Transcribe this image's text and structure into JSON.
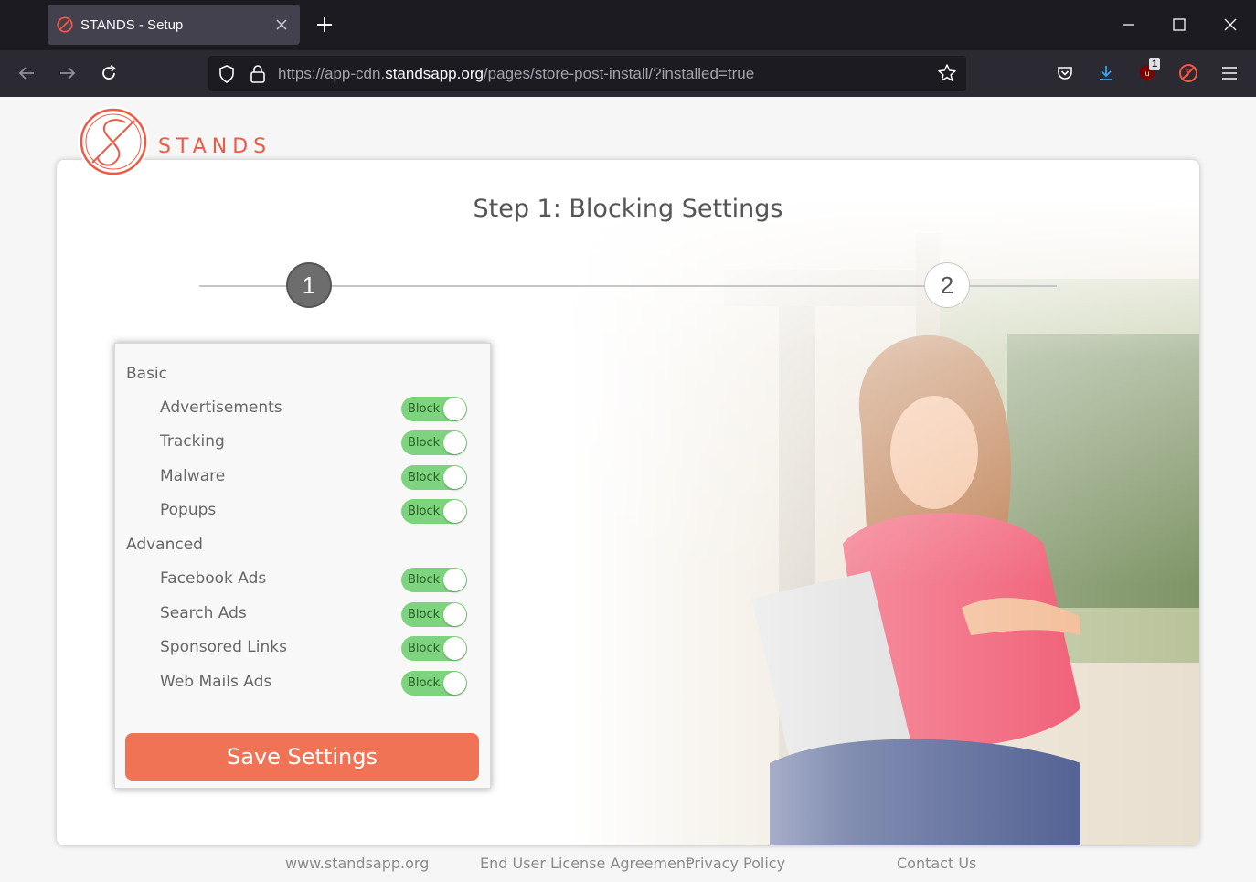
{
  "browser": {
    "tab_title": "STANDS - Setup",
    "url_prefix": "https://app-cdn.",
    "url_host": "standsapp.org",
    "url_path": "/pages/store-post-install/?installed=true",
    "extension_badge": "1",
    "icons": {
      "back": "arrow-left-icon",
      "forward": "arrow-right-icon",
      "reload": "reload-icon",
      "shield": "shield-icon",
      "lock": "lock-icon",
      "bookmark": "star-icon",
      "pocket": "pocket-icon",
      "downloads": "download-icon",
      "ublock": "ublock-icon",
      "stands": "stands-extension-icon",
      "menu": "hamburger-menu-icon"
    }
  },
  "page": {
    "brand": "STANDS",
    "step_title": "Step 1: Blocking Settings",
    "steps": [
      "1",
      "2"
    ],
    "sections": [
      {
        "title": "Basic",
        "items": [
          {
            "label": "Advertisements",
            "state": "Block"
          },
          {
            "label": "Tracking",
            "state": "Block"
          },
          {
            "label": "Malware",
            "state": "Block"
          },
          {
            "label": "Popups",
            "state": "Block"
          }
        ]
      },
      {
        "title": "Advanced",
        "items": [
          {
            "label": "Facebook Ads",
            "state": "Block"
          },
          {
            "label": "Search Ads",
            "state": "Block"
          },
          {
            "label": "Sponsored Links",
            "state": "Block"
          },
          {
            "label": "Web Mails Ads",
            "state": "Block"
          }
        ]
      }
    ],
    "save_button": "Save Settings",
    "footer": {
      "website": "www.standsapp.org",
      "eula": "End User License Agreement",
      "privacy": "Privacy Policy",
      "contact": "Contact Us"
    }
  },
  "colors": {
    "brand": "#ef5a45",
    "save_button": "#f07355",
    "toggle_on": "#7ed47e",
    "chrome_dark": "#1c1b22",
    "chrome_toolbar": "#2b2a33"
  }
}
